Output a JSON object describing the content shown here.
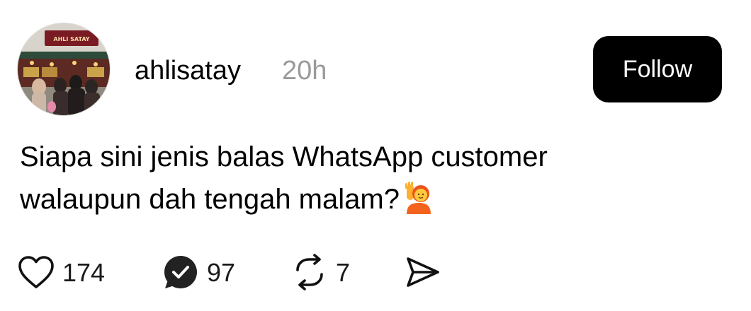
{
  "post": {
    "username": "ahlisatay",
    "timestamp": "20h",
    "follow_label": "Follow",
    "text_lines": [
      "Siapa sini jenis balas WhatsApp customer",
      "walaupun dah tengah malam?"
    ],
    "emoji": "person-raising-hand-emoji",
    "avatar_sign_text": "AHLI SATAY"
  },
  "actions": {
    "likes": "174",
    "replies": "97",
    "reposts": "7"
  },
  "icons": {
    "like": "heart-icon",
    "reply": "reply-badge-icon",
    "repost": "repost-icon",
    "share": "send-icon"
  },
  "colors": {
    "follow_bg": "#000000",
    "follow_text": "#ffffff",
    "timestamp": "#9a9a9a",
    "text": "#000000"
  }
}
